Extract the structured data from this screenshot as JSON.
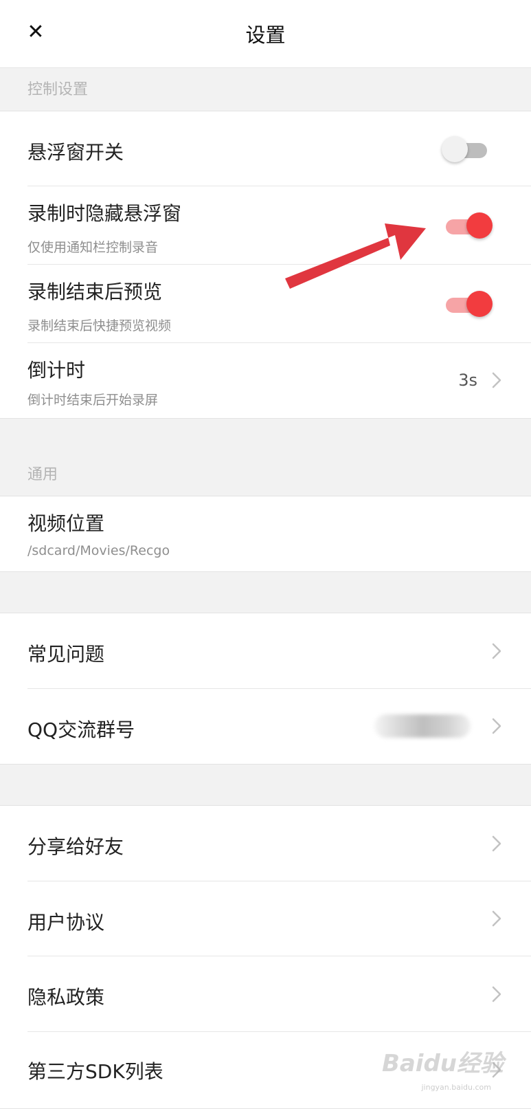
{
  "header": {
    "title": "设置",
    "close_icon": "close-icon"
  },
  "sections": {
    "control_label": "控制设置",
    "general_label": "通用"
  },
  "control": {
    "floating_switch": {
      "title": "悬浮窗开关",
      "on": false
    },
    "hide_floating": {
      "title": "录制时隐藏悬浮窗",
      "subtitle": "仅使用通知栏控制录音",
      "on": true
    },
    "preview_after": {
      "title": "录制结束后预览",
      "subtitle": "录制结束后快捷预览视频",
      "on": true
    },
    "countdown": {
      "title": "倒计时",
      "subtitle": "倒计时结束后开始录屏",
      "value": "3s"
    }
  },
  "general": {
    "video_location": {
      "title": "视频位置",
      "subtitle": "/sdcard/Movies/Recgo"
    }
  },
  "support": {
    "faq": {
      "title": "常见问题"
    },
    "qq_group": {
      "title": "QQ交流群号"
    }
  },
  "about": {
    "share": {
      "title": "分享给好友"
    },
    "user_agreement": {
      "title": "用户协议"
    },
    "privacy_policy": {
      "title": "隐私政策"
    },
    "third_party_sdk": {
      "title": "第三方SDK列表"
    }
  },
  "watermark": {
    "brand": "Baidu经验",
    "url": "jingyan.baidu.com"
  },
  "colors": {
    "accent": "#f23c3f",
    "accent_track": "#f6a4a6",
    "annotation_arrow": "#e0363f"
  }
}
